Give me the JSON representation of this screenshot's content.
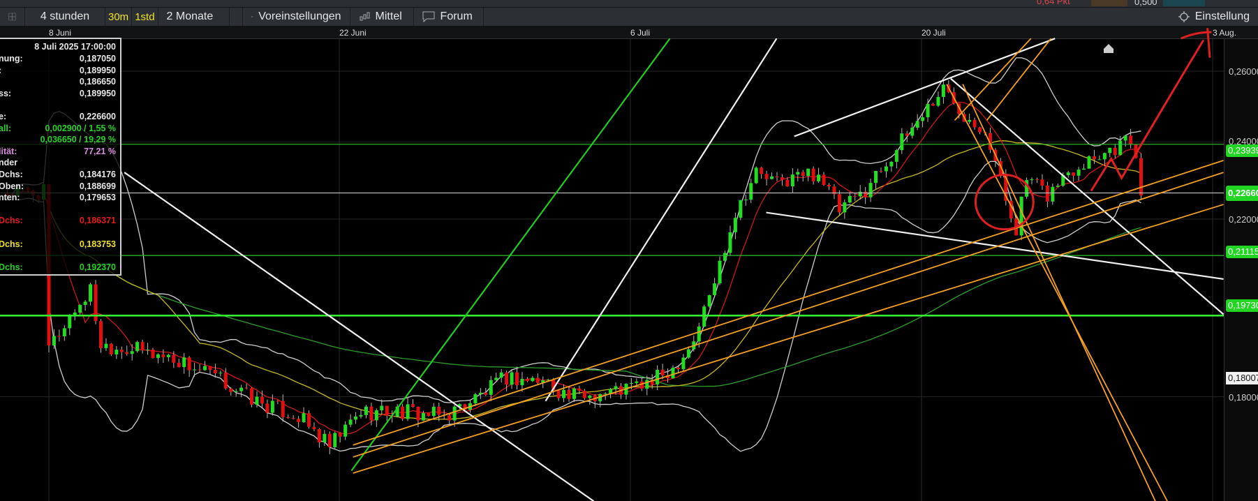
{
  "top_strip": {
    "change_text": "0,64 Pkt",
    "value": "0,500"
  },
  "toolbar": {
    "layout_icon": "grid-layout-icon",
    "period": "4 stunden",
    "interval_30m": "30m",
    "interval_1std": "1std",
    "range": "2 Monate",
    "presets": "Voreinstellungen",
    "indicators": "Mittel",
    "forum": "Forum",
    "settings": "Einstellung"
  },
  "date_axis": [
    "8 Juni",
    "22 Juni",
    "6 Juli",
    "20 Juli",
    "3 Aug."
  ],
  "price_axis": [
    "0,26000",
    "0,24000",
    "0,22000",
    "0,18000"
  ],
  "price_badges": {
    "level1": "0,23939",
    "current": "0,22660",
    "level2": "0,21115",
    "level3": "0,19730",
    "low_marker": "0,18007"
  },
  "tooltip": {
    "datetime": "8 Juli 2025 17:00:00",
    "rows": [
      {
        "label": "nung:",
        "value": "0,187050",
        "color": "white"
      },
      {
        "label": ":",
        "value": "0,189950",
        "color": "white"
      },
      {
        "label": "",
        "value": "0,186650",
        "color": "white"
      },
      {
        "label": "ss:",
        "value": "0,189950",
        "color": "white"
      },
      {
        "label": "",
        "value": "",
        "color": "white"
      },
      {
        "label": "e:",
        "value": "0,226600",
        "color": "white"
      },
      {
        "label": "all:",
        "value": "0,002900 / 1,55 %",
        "color": "green"
      },
      {
        "label": "",
        "value": "0,036650 / 19,29 %",
        "color": "green"
      },
      {
        "label": "lität:",
        "value": "77,21 %",
        "color": "purple"
      },
      {
        "label": "nder",
        "value": "",
        "color": "white"
      },
      {
        "label": "Dchs:",
        "value": "0,184176",
        "color": "white"
      },
      {
        "label": "Oben:",
        "value": "0,188699",
        "color": "white"
      },
      {
        "label": "nten:",
        "value": "0,179653",
        "color": "white"
      },
      {
        "label": "",
        "value": "",
        "color": "white"
      },
      {
        "label": "Dchs:",
        "value": "0,186371",
        "color": "red"
      },
      {
        "label": "",
        "value": "",
        "color": "white"
      },
      {
        "label": "Dchs:",
        "value": "0,183753",
        "color": "yellow"
      },
      {
        "label": "",
        "value": "",
        "color": "white"
      },
      {
        "label": "Dchs:",
        "value": "0,192370",
        "color": "green"
      }
    ]
  },
  "colors": {
    "up": "#22dd22",
    "down": "#e01010",
    "ma_fast": "#d01818",
    "ma_mid": "#c8b820",
    "ma_slow": "#2aa02a",
    "bands": "#cfcfcf",
    "trend_orange": "#f5a020",
    "trend_white": "#f0f0f0",
    "annotation": "#e02020"
  },
  "chart_data": {
    "type": "candlestick",
    "scale": "log",
    "x_unit": "days since 8 Juni",
    "keyframes": [
      [
        0,
        0.19
      ],
      [
        1,
        0.197
      ],
      [
        2,
        0.203
      ],
      [
        2.5,
        0.191
      ],
      [
        4,
        0.19
      ],
      [
        6,
        0.188
      ],
      [
        8,
        0.184
      ],
      [
        10,
        0.179
      ],
      [
        12,
        0.176
      ],
      [
        13,
        0.172
      ],
      [
        13.5,
        0.17
      ],
      [
        15,
        0.177
      ],
      [
        17,
        0.177
      ],
      [
        19,
        0.176
      ],
      [
        21,
        0.181
      ],
      [
        22,
        0.184
      ],
      [
        24,
        0.183
      ],
      [
        25,
        0.18
      ],
      [
        27,
        0.181
      ],
      [
        29,
        0.183
      ],
      [
        30,
        0.186
      ],
      [
        31,
        0.192
      ],
      [
        32,
        0.205
      ],
      [
        33,
        0.222
      ],
      [
        34,
        0.232
      ],
      [
        35,
        0.229
      ],
      [
        36,
        0.231
      ],
      [
        37,
        0.232
      ],
      [
        38,
        0.222
      ],
      [
        39,
        0.226
      ],
      [
        40,
        0.233
      ],
      [
        41,
        0.24
      ],
      [
        42,
        0.248
      ],
      [
        43,
        0.255
      ],
      [
        44,
        0.248
      ],
      [
        45,
        0.244
      ],
      [
        46,
        0.225
      ],
      [
        46.5,
        0.218
      ],
      [
        47,
        0.23
      ],
      [
        48,
        0.226
      ],
      [
        49,
        0.232
      ],
      [
        50,
        0.236
      ],
      [
        51,
        0.238
      ],
      [
        52,
        0.241
      ],
      [
        52.5,
        0.2266
      ]
    ],
    "horizontal_levels": [
      0.23939,
      0.2266,
      0.21115,
      0.1973
    ],
    "yrange": [
      0.165,
      0.27
    ]
  }
}
